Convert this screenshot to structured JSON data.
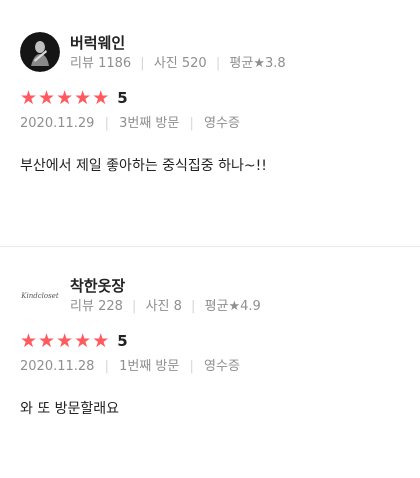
{
  "reviews": [
    {
      "name": "버럭웨인",
      "stats": {
        "reviews_label": "리뷰",
        "reviews_count": "1186",
        "photos_label": "사진",
        "photos_count": "520",
        "avg_label": "평균",
        "star_glyph": "★",
        "avg_value": "3.8"
      },
      "rating": {
        "stars": 5,
        "score": "5"
      },
      "date": "2020.11.29",
      "visit": "3번째 방문",
      "receipt": "영수증",
      "text": "부산에서 제일 좋아하는 중식집중 하나~!!",
      "avatar": "profile-photo-dark",
      "avatar_color": "#1a1a1a"
    },
    {
      "name": "착한옷장",
      "stats": {
        "reviews_label": "리뷰",
        "reviews_count": "228",
        "photos_label": "사진",
        "photos_count": "8",
        "avg_label": "평균",
        "star_glyph": "★",
        "avg_value": "4.9"
      },
      "rating": {
        "stars": 5,
        "score": "5"
      },
      "date": "2020.11.28",
      "visit": "1번째 방문",
      "receipt": "영수증",
      "text": "와 또 방문할래요",
      "avatar": "logo-kindcloset",
      "logo_text": "Kindcloset"
    }
  ],
  "colors": {
    "star": "#ff5a5f",
    "muted": "#8f8f8f",
    "divider": "#ececec"
  }
}
